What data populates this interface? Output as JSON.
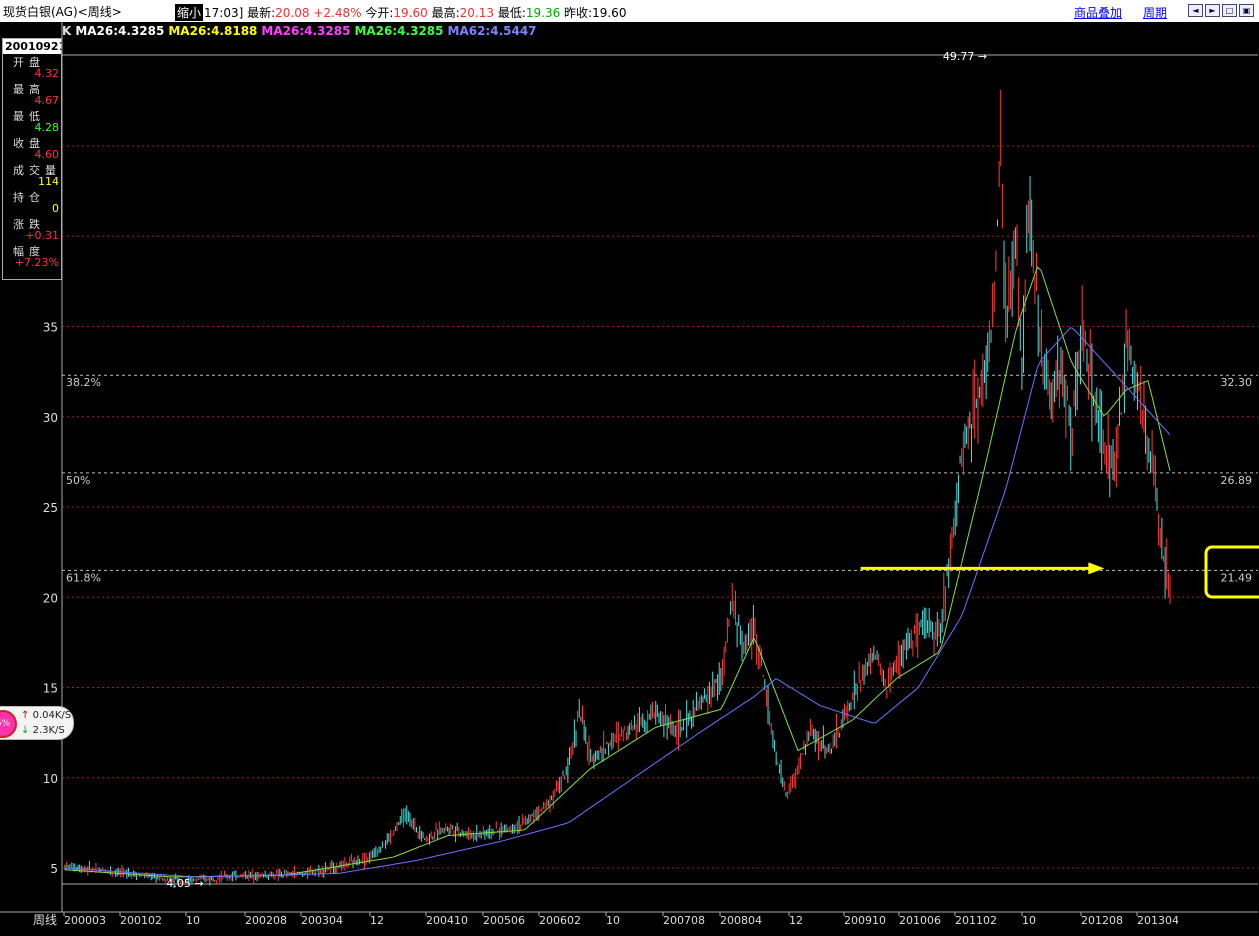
{
  "window": {
    "title": "现货白银(AG)<周线>",
    "shrink_label": "缩小",
    "time": "17:03]",
    "latest_label": "最新:",
    "latest_value": "20.08",
    "change": "+2.48%",
    "open_label": "今开:",
    "open_value": "19.60",
    "high_label": "最高:",
    "high_value": "20.13",
    "low_label": "最低:",
    "low_value": "19.36",
    "prevclose_label": "昨收:",
    "prevclose_value": "19.60",
    "overlay_link": "商品叠加",
    "period_link": "周期"
  },
  "ma_legend": [
    {
      "text": "K",
      "color": "#dddddd"
    },
    {
      "text": "MA26:4.3285",
      "color": "#ffffff"
    },
    {
      "text": "MA26:4.8188",
      "color": "#ffff00"
    },
    {
      "text": "MA26:4.3285",
      "color": "#ff40ff"
    },
    {
      "text": "MA26:4.3285",
      "color": "#40ff40"
    },
    {
      "text": "MA62:4.5447",
      "color": "#8080ff"
    }
  ],
  "info_panel": {
    "date": "20010921",
    "rows": [
      {
        "label": "开盘",
        "value": "4.32",
        "color": "#ff3333"
      },
      {
        "label": "最高",
        "value": "4.67",
        "color": "#ff3333"
      },
      {
        "label": "最低",
        "value": "4.28",
        "color": "#33ff33"
      },
      {
        "label": "收盘",
        "value": "4.60",
        "color": "#ff3333"
      },
      {
        "label": "成交量",
        "value": "114",
        "color": "#ffff00"
      },
      {
        "label": "持仓",
        "value": "0",
        "color": "#ffff00"
      },
      {
        "label": "涨跌",
        "value": "+0.31",
        "color": "#ff3333"
      },
      {
        "label": "幅度",
        "value": "+7.23%",
        "color": "#ff3333"
      }
    ]
  },
  "network_widget": {
    "percent": "5%",
    "upload": "0.04K/S",
    "download": "2.3K/S"
  },
  "colors": {
    "up": "#ff3b3b",
    "down": "#48e0e0",
    "ma_short": "#80e040",
    "ma_long": "#7070ff",
    "grid": "#a02020",
    "fib": "#bbbbbb",
    "arrow": "#ffff00"
  },
  "chart_data": {
    "type": "candlestick",
    "period_label": "周线",
    "y_ticks": [
      5,
      10,
      15,
      20,
      25,
      30,
      35
    ],
    "ylim": [
      3,
      52
    ],
    "x_ticks": [
      "200003",
      "200102",
      "10",
      "200208",
      "200304",
      "12",
      "200410",
      "200506",
      "200602",
      "10",
      "200708",
      "200804",
      "12",
      "200910",
      "201006",
      "201102",
      "10",
      "201208",
      "201304"
    ],
    "max_label": "49.77",
    "min_label": "4.05",
    "fibonacci": [
      {
        "label": "38.2%",
        "value": 32.3,
        "value_label": "32.30"
      },
      {
        "label": "50%",
        "value": 26.89,
        "value_label": "26.89"
      },
      {
        "label": "61.8%",
        "value": 21.49,
        "value_label": "21.49"
      }
    ],
    "price_path": [
      [
        0,
        5.1
      ],
      [
        0.03,
        4.9
      ],
      [
        0.06,
        4.7
      ],
      [
        0.09,
        4.4
      ],
      [
        0.11,
        4.3
      ],
      [
        0.13,
        4.4
      ],
      [
        0.16,
        4.6
      ],
      [
        0.19,
        4.6
      ],
      [
        0.22,
        4.7
      ],
      [
        0.25,
        5.1
      ],
      [
        0.28,
        5.6
      ],
      [
        0.3,
        6.9
      ],
      [
        0.31,
        8.0
      ],
      [
        0.33,
        6.6
      ],
      [
        0.35,
        7.3
      ],
      [
        0.37,
        6.8
      ],
      [
        0.4,
        7.1
      ],
      [
        0.42,
        7.5
      ],
      [
        0.44,
        8.5
      ],
      [
        0.46,
        10.4
      ],
      [
        0.47,
        13.8
      ],
      [
        0.48,
        11.0
      ],
      [
        0.5,
        12.0
      ],
      [
        0.52,
        13.0
      ],
      [
        0.54,
        13.6
      ],
      [
        0.56,
        12.5
      ],
      [
        0.58,
        14.0
      ],
      [
        0.6,
        15.5
      ],
      [
        0.61,
        20.0
      ],
      [
        0.62,
        17.0
      ],
      [
        0.63,
        18.5
      ],
      [
        0.64,
        15.0
      ],
      [
        0.65,
        11.0
      ],
      [
        0.66,
        9.0
      ],
      [
        0.67,
        10.5
      ],
      [
        0.68,
        12.5
      ],
      [
        0.7,
        11.5
      ],
      [
        0.72,
        14.5
      ],
      [
        0.74,
        17.0
      ],
      [
        0.75,
        15.0
      ],
      [
        0.77,
        17.5
      ],
      [
        0.79,
        18.5
      ],
      [
        0.8,
        18.0
      ],
      [
        0.81,
        23.0
      ],
      [
        0.82,
        28.0
      ],
      [
        0.83,
        30.5
      ],
      [
        0.84,
        32.0
      ],
      [
        0.85,
        37.0
      ],
      [
        0.855,
        45.0
      ],
      [
        0.86,
        35.0
      ],
      [
        0.87,
        40.0
      ],
      [
        0.875,
        32.0
      ],
      [
        0.88,
        42.0
      ],
      [
        0.89,
        35.0
      ],
      [
        0.9,
        31.0
      ],
      [
        0.91,
        33.0
      ],
      [
        0.92,
        29.0
      ],
      [
        0.93,
        35.0
      ],
      [
        0.94,
        31.0
      ],
      [
        0.95,
        28.0
      ],
      [
        0.96,
        27.0
      ],
      [
        0.97,
        34.0
      ],
      [
        0.98,
        32.0
      ],
      [
        0.99,
        29.0
      ],
      [
        1.0,
        24.0
      ],
      [
        1.01,
        20.08
      ]
    ],
    "ma_short_path": [
      [
        0,
        4.9
      ],
      [
        0.1,
        4.5
      ],
      [
        0.2,
        4.6
      ],
      [
        0.3,
        5.6
      ],
      [
        0.35,
        6.8
      ],
      [
        0.42,
        7.1
      ],
      [
        0.48,
        10.5
      ],
      [
        0.54,
        12.8
      ],
      [
        0.6,
        13.8
      ],
      [
        0.63,
        17.8
      ],
      [
        0.67,
        11.5
      ],
      [
        0.72,
        13.2
      ],
      [
        0.76,
        15.5
      ],
      [
        0.8,
        17.0
      ],
      [
        0.84,
        27.0
      ],
      [
        0.87,
        35.0
      ],
      [
        0.89,
        38.5
      ],
      [
        0.92,
        33.0
      ],
      [
        0.95,
        30.0
      ],
      [
        0.97,
        31.5
      ],
      [
        0.99,
        32.0
      ],
      [
        1.01,
        27.0
      ]
    ],
    "ma_long_path": [
      [
        0,
        5.0
      ],
      [
        0.12,
        4.5
      ],
      [
        0.25,
        4.7
      ],
      [
        0.32,
        5.4
      ],
      [
        0.4,
        6.5
      ],
      [
        0.46,
        7.5
      ],
      [
        0.52,
        10.0
      ],
      [
        0.58,
        12.5
      ],
      [
        0.63,
        14.5
      ],
      [
        0.65,
        15.5
      ],
      [
        0.69,
        14.0
      ],
      [
        0.74,
        13.0
      ],
      [
        0.78,
        15.0
      ],
      [
        0.82,
        19.0
      ],
      [
        0.86,
        26.0
      ],
      [
        0.89,
        33.0
      ],
      [
        0.92,
        35.0
      ],
      [
        0.95,
        33.0
      ],
      [
        0.98,
        31.0
      ],
      [
        1.01,
        29.0
      ]
    ],
    "arrow": {
      "from_x": 0.73,
      "to_x": 0.95,
      "y": 21.6
    }
  }
}
